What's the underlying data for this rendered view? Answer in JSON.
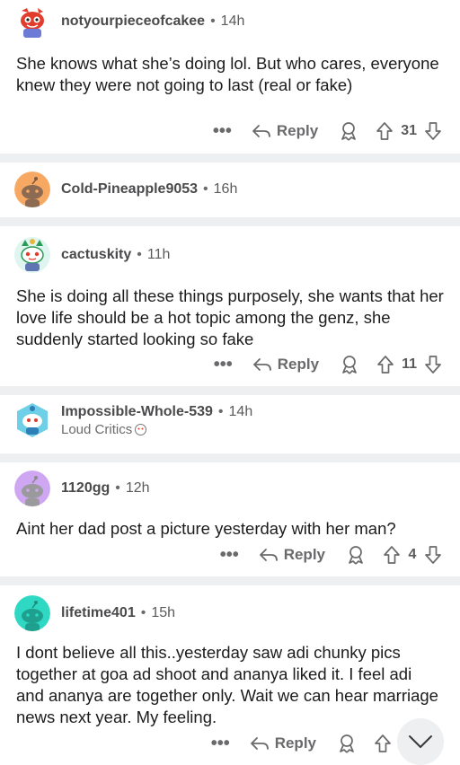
{
  "comments": [
    {
      "username": "notyourpieceofcakee",
      "age": "14h",
      "body": "She knows what she’s doing lol. But who cares, everyone knew they were not going to last (real or fake)",
      "reply_label": "Reply",
      "votes": "31",
      "avatar_color": "#ffffff"
    },
    {
      "username": "Cold-Pineapple9053",
      "age": "16h",
      "avatar_color": "#f7a863"
    },
    {
      "username": "cactuskity",
      "age": "11h",
      "body": "She is doing all these things purposely, she wants that her love life should be a hot topic among the genz, she suddenly started looking so fake",
      "reply_label": "Reply",
      "votes": "11",
      "avatar_color": "#dff5ef"
    },
    {
      "username": "Impossible-Whole-539",
      "age": "14h",
      "flair": "Loud Critics",
      "avatar_color": "#6fcfe6"
    },
    {
      "username": "1120gg",
      "age": "12h",
      "body": "Aint her dad post a picture yesterday with her man?",
      "reply_label": "Reply",
      "votes": "4",
      "avatar_color": "#cfa6f2"
    },
    {
      "username": "lifetime401",
      "age": "15h",
      "body": "I dont believe all this..yesterday saw adi chunky pics together at goa ad shoot and ananya liked it. I feel adi and ananya are together only. Wait we can hear marriage news next year.  My feeling.",
      "reply_label": "Reply",
      "votes": "",
      "avatar_color": "#2fd8c2"
    }
  ],
  "more_label": "•••",
  "dot": "•",
  "icons": {
    "reply": "reply-arrow-icon",
    "award": "award-icon",
    "upvote": "upvote-arrow-icon",
    "downvote": "downvote-arrow-icon",
    "scroll": "chevron-down-icon"
  }
}
